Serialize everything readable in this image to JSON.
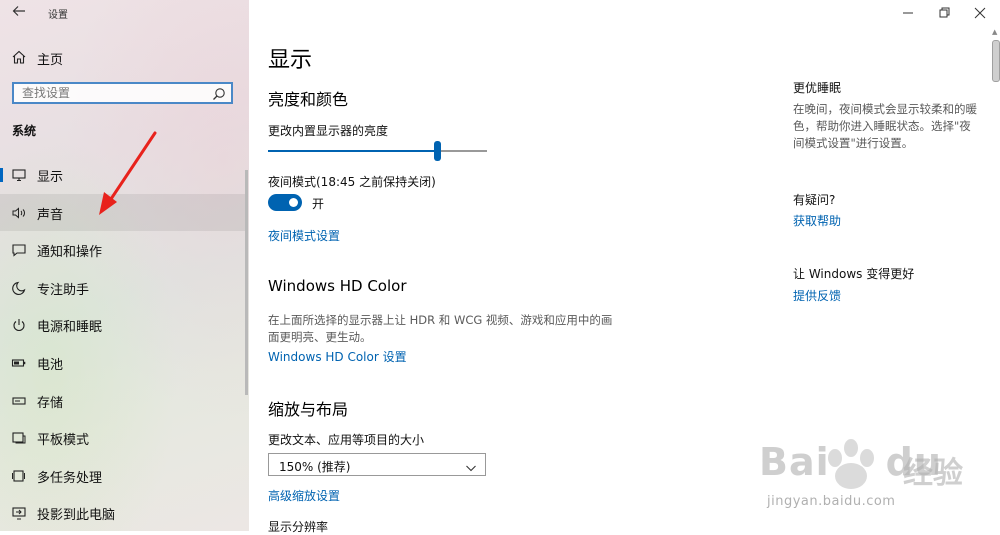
{
  "window": {
    "title": "设置"
  },
  "sidebar": {
    "home_label": "主页",
    "search_placeholder": "查找设置",
    "section_label": "系统",
    "items": [
      {
        "label": "显示",
        "icon": "monitor-icon",
        "selected": true
      },
      {
        "label": "声音",
        "icon": "speaker-icon"
      },
      {
        "label": "通知和操作",
        "icon": "notification-icon"
      },
      {
        "label": "专注助手",
        "icon": "moon-icon"
      },
      {
        "label": "电源和睡眠",
        "icon": "power-icon"
      },
      {
        "label": "电池",
        "icon": "battery-icon"
      },
      {
        "label": "存储",
        "icon": "storage-icon"
      },
      {
        "label": "平板模式",
        "icon": "tablet-icon"
      },
      {
        "label": "多任务处理",
        "icon": "multitask-icon"
      },
      {
        "label": "投影到此电脑",
        "icon": "project-icon"
      }
    ],
    "annotation_color": "#e8221c"
  },
  "main": {
    "page_title": "显示",
    "brightness": {
      "heading": "亮度和颜色",
      "slider_label": "更改内置显示器的亮度",
      "slider_value": 0.77,
      "night_mode_label": "夜间模式(18:45 之前保持关闭)",
      "toggle_state": "开",
      "toggle_on": true,
      "night_settings_link": "夜间模式设置"
    },
    "hdr": {
      "heading": "Windows HD Color",
      "description_line1": "在上面所选择的显示器上让 HDR 和 WCG 视频、游戏和应用中的画",
      "description_line2": "面更明亮、更生动。",
      "link": "Windows HD Color 设置"
    },
    "scale": {
      "heading": "缩放与布局",
      "size_label": "更改文本、应用等项目的大小",
      "size_value": "150% (推荐)",
      "advanced_link": "高级缩放设置",
      "resolution_label": "显示分辨率"
    }
  },
  "right_panel": {
    "sleep_heading": "更优睡眠",
    "sleep_text_line1": "在晚间，夜间模式会显示较柔和的暖",
    "sleep_text_line2": "色，帮助你进入睡眠状态。选择\"夜",
    "sleep_text_line3": "间模式设置\"进行设置。",
    "question_heading": "有疑问?",
    "help_link": "获取帮助",
    "improve_heading": "让 Windows 变得更好",
    "feedback_link": "提供反馈"
  },
  "watermark": {
    "brand_latin": "Bai",
    "brand_du": "du",
    "brand_cn": "经验",
    "url": "jingyan.baidu.com"
  },
  "colors": {
    "accent": "#0063b1",
    "link": "#0063b1",
    "selected_bar": "#0066c0"
  }
}
